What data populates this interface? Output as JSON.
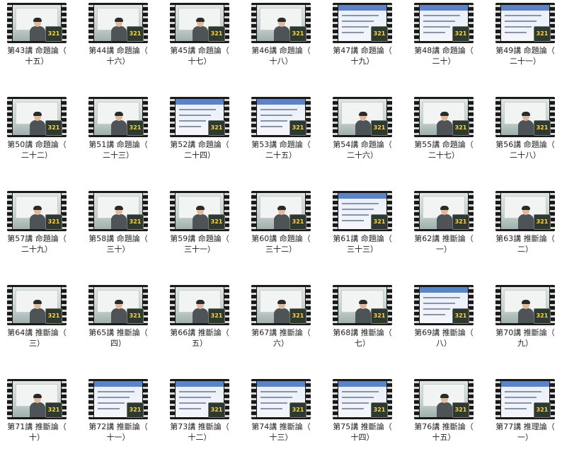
{
  "badge_text": "321",
  "items": [
    {
      "label": "第43講 命題論（\n十五）",
      "kind": "video"
    },
    {
      "label": "第44講 命題論（\n十六）",
      "kind": "video"
    },
    {
      "label": "第45講 命題論（\n十七）",
      "kind": "video"
    },
    {
      "label": "第46講 命題論（\n十八）",
      "kind": "video"
    },
    {
      "label": "第47講 命題論（\n十九）",
      "kind": "slide"
    },
    {
      "label": "第48講 命題論（\n二十）",
      "kind": "slide"
    },
    {
      "label": "第49講 命題論（\n二十一）",
      "kind": "slide"
    },
    {
      "label": "第50講 命題論（\n二十二）",
      "kind": "video"
    },
    {
      "label": "第51講 命題論（\n二十三）",
      "kind": "video"
    },
    {
      "label": "第52講 命題論（\n二十四）",
      "kind": "slide"
    },
    {
      "label": "第53講 命題論（\n二十五）",
      "kind": "slide"
    },
    {
      "label": "第54講 命題論（\n二十六）",
      "kind": "video"
    },
    {
      "label": "第55講 命題論（\n二十七）",
      "kind": "video"
    },
    {
      "label": "第56講 命題論（\n二十八）",
      "kind": "video"
    },
    {
      "label": "第57講 命題論（\n二十九）",
      "kind": "video"
    },
    {
      "label": "第58講 命題論（\n三十）",
      "kind": "video"
    },
    {
      "label": "第59講 命題論（\n三十一）",
      "kind": "video"
    },
    {
      "label": "第60講 命題論（\n三十二）",
      "kind": "video"
    },
    {
      "label": "第61講 命題論（\n三十三）",
      "kind": "slide"
    },
    {
      "label": "第62講 推斷論（\n一）",
      "kind": "video"
    },
    {
      "label": "第63講 推斷論（\n二）",
      "kind": "video"
    },
    {
      "label": "第64講 推斷論（\n三）",
      "kind": "video"
    },
    {
      "label": "第65講 推斷論（\n四）",
      "kind": "video"
    },
    {
      "label": "第66講 推斷論（\n五）",
      "kind": "video"
    },
    {
      "label": "第67講 推斷論（\n六）",
      "kind": "video"
    },
    {
      "label": "第68講 推斷論（\n七）",
      "kind": "video"
    },
    {
      "label": "第69講 推斷論（\n八）",
      "kind": "slide"
    },
    {
      "label": "第70講 推斷論（\n九）",
      "kind": "video"
    },
    {
      "label": "第71講 推斷論（\n十）",
      "kind": "video"
    },
    {
      "label": "第72講 推斷論（\n十一）",
      "kind": "slide"
    },
    {
      "label": "第73講 推斷論（\n十二）",
      "kind": "slide"
    },
    {
      "label": "第74講 推斷論（\n十三）",
      "kind": "slide"
    },
    {
      "label": "第75講 推斷論（\n十四）",
      "kind": "slide"
    },
    {
      "label": "第76講 推斷論（\n十五）",
      "kind": "video"
    },
    {
      "label": "第77講 推理論（\n一）",
      "kind": "slide"
    }
  ]
}
